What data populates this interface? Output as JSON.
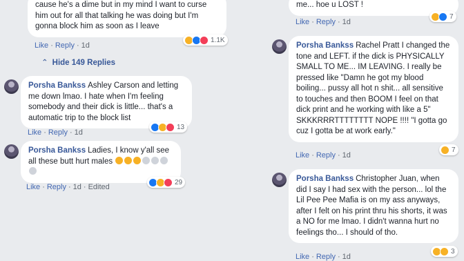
{
  "left": {
    "top_comment": {
      "text": "cause he's a dime but in my mind I want to curse him out for all that talking he was doing but I'm gonna block him as soon as I leave",
      "actions": {
        "like": "Like",
        "reply": "Reply",
        "time": "1d"
      },
      "reaction_count": "1.1K"
    },
    "hide_replies": {
      "arrow": "⌃",
      "label": "Hide 149 Replies"
    },
    "replies": [
      {
        "author": "Porsha Bankss",
        "text": "Ashley Carson and letting me down lmao. I hate when I'm feeling somebody and their dick is little... that's a automatic trip to the block list",
        "actions": {
          "like": "Like",
          "reply": "Reply",
          "time": "1d"
        },
        "reaction_count": "13"
      },
      {
        "author": "Porsha Bankss",
        "text": "Ladies, I know y'all see all these butt hurt males",
        "actions": {
          "like": "Like",
          "reply": "Reply",
          "time": "1d",
          "edited": "Edited"
        },
        "reaction_count": "29"
      }
    ]
  },
  "right": {
    "top_comment": {
      "text": "me... hoe u LOST !",
      "actions": {
        "like": "Like",
        "reply": "Reply",
        "time": "1d"
      },
      "reaction_count": "7"
    },
    "replies": [
      {
        "author": "Porsha Bankss",
        "text": "Rachel Pratt I changed the tone and LEFT. if the dick is PHYSICALLY SMALL TO ME... IM LEAVING. I really be pressed like \"Damn he got my blood boiling... pussy all hot n shit... all sensitive to touches and then BOOM I feel on that dick print and he working with like a 5\" SKKKRRRTTTTTTTT NOPE !!!! \"I gotta go cuz I gotta be at work early.\"",
        "actions": {
          "like": "Like",
          "reply": "Reply",
          "time": "1d"
        },
        "reaction_count": "7"
      },
      {
        "author": "Porsha Bankss",
        "text": "Christopher Juan, when did I say I had sex with the person... lol the Lil Pee Pee Mafia is on my ass anyways, after I felt on his print thru his shorts, it was a NO for me lmao. I didn't wanna hurt no feelings tho... I should of tho.",
        "actions": {
          "like": "Like",
          "reply": "Reply",
          "time": "1d"
        },
        "reaction_count": "3"
      }
    ]
  }
}
